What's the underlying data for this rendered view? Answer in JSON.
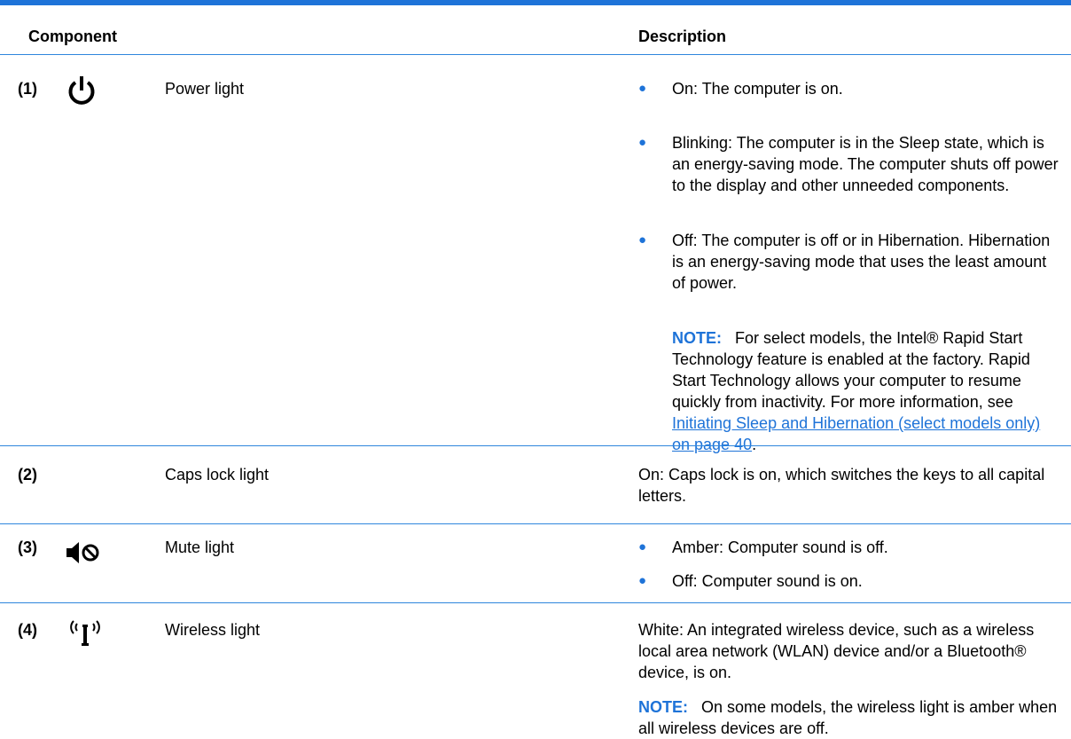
{
  "header": {
    "component": "Component",
    "description": "Description"
  },
  "rows": [
    {
      "number": "(1)",
      "icon": "power-icon",
      "component": "Power light",
      "bullets": [
        "On: The computer is on.",
        "Blinking: The computer is in the Sleep state, which is an energy-saving mode. The computer shuts off power to the display and other unneeded components.",
        "Off: The computer is off or in Hibernation. Hibernation is an energy-saving mode that uses the least amount of power."
      ],
      "note": {
        "label": "NOTE:",
        "text": "For select models, the Intel® Rapid Start Technology feature is enabled at the factory. Rapid Start Technology allows your computer to resume quickly from inactivity. For more information, see",
        "link": "Initiating Sleep and Hibernation (select models only) on page 40",
        "tail": "."
      }
    },
    {
      "number": "(2)",
      "component": "Caps lock light",
      "description": "On: Caps lock is on, which switches the keys to all capital letters."
    },
    {
      "number": "(3)",
      "icon": "mute-icon",
      "component": "Mute light",
      "bullets": [
        "Amber: Computer sound is off.",
        "Off: Computer sound is on."
      ]
    },
    {
      "number": "(4)",
      "icon": "wireless-icon",
      "component": "Wireless light",
      "description": "White: An integrated wireless device, such as a wireless local area network (WLAN) device and/or a Bluetooth® device, is on.",
      "note": {
        "label": "NOTE:",
        "text": "On some models, the wireless light is amber when all wireless devices are off."
      }
    }
  ],
  "colors": {
    "accent": "#1e73d8"
  }
}
